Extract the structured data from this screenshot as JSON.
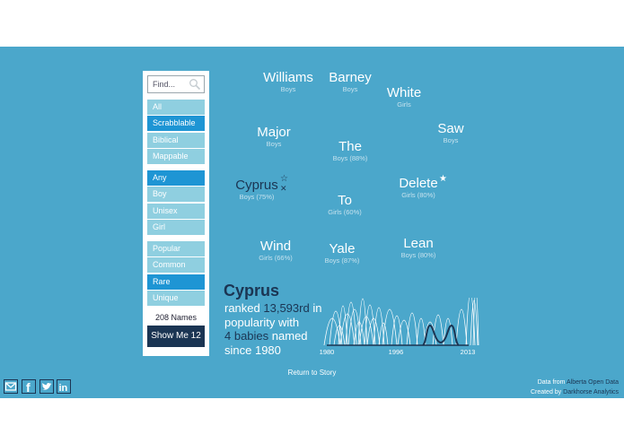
{
  "search": {
    "placeholder": "Find..."
  },
  "filters": {
    "group1": [
      {
        "label": "All",
        "active": false
      },
      {
        "label": "Scrabblable",
        "active": true
      },
      {
        "label": "Biblical",
        "active": false
      },
      {
        "label": "Mappable",
        "active": false
      }
    ],
    "group2": [
      {
        "label": "Any",
        "active": true
      },
      {
        "label": "Boy",
        "active": false
      },
      {
        "label": "Unisex",
        "active": false
      },
      {
        "label": "Girl",
        "active": false
      }
    ],
    "group3": [
      {
        "label": "Popular",
        "active": false
      },
      {
        "label": "Common",
        "active": false
      },
      {
        "label": "Rare",
        "active": true
      },
      {
        "label": "Unique",
        "active": false
      }
    ]
  },
  "names_count": "208 Names",
  "show_button": "Show Me 12",
  "words": [
    {
      "name": "Williams",
      "sub": "Boys"
    },
    {
      "name": "Barney",
      "sub": "Boys"
    },
    {
      "name": "White",
      "sub": "Girls"
    },
    {
      "name": "Major",
      "sub": "Boys"
    },
    {
      "name": "The",
      "sub": "Boys (88%)"
    },
    {
      "name": "Saw",
      "sub": "Boys"
    },
    {
      "name": "Cyprus",
      "sub": "Boys (75%)",
      "selected": true
    },
    {
      "name": "To",
      "sub": "Girls (60%)"
    },
    {
      "name": "Delete",
      "sub": "Girls (80%)"
    },
    {
      "name": "Wind",
      "sub": "Girls (66%)"
    },
    {
      "name": "Yale",
      "sub": "Boys (87%)"
    },
    {
      "name": "Lean",
      "sub": "Boys (80%)"
    }
  ],
  "detail": {
    "name": "Cyprus",
    "line_ranked": "ranked",
    "rank": "13,593rd",
    "line_in": "in",
    "line_popularity": "popularity with",
    "babies": "4 babies",
    "line_named": "named",
    "line_since": "since 1980"
  },
  "chart_data": {
    "type": "line",
    "x_ticks": [
      "1980",
      "1996",
      "2013"
    ],
    "xlim": [
      1980,
      2013
    ],
    "highlight_series": "Cyprus",
    "highlight_peaks": [
      2004,
      2009
    ]
  },
  "return_link": "Return to Story",
  "social": [
    "email-icon",
    "facebook-icon",
    "twitter-icon",
    "linkedin-icon"
  ],
  "credits": {
    "data_from": "Data from",
    "data_source": "Alberta Open Data",
    "created_by": "Created by",
    "creator": "Darkhorse Analytics"
  },
  "colors": {
    "background": "#4ba7cb",
    "active_filter": "#1e95d4",
    "inactive_filter": "#8fcfe0",
    "dark": "#1b3553"
  }
}
